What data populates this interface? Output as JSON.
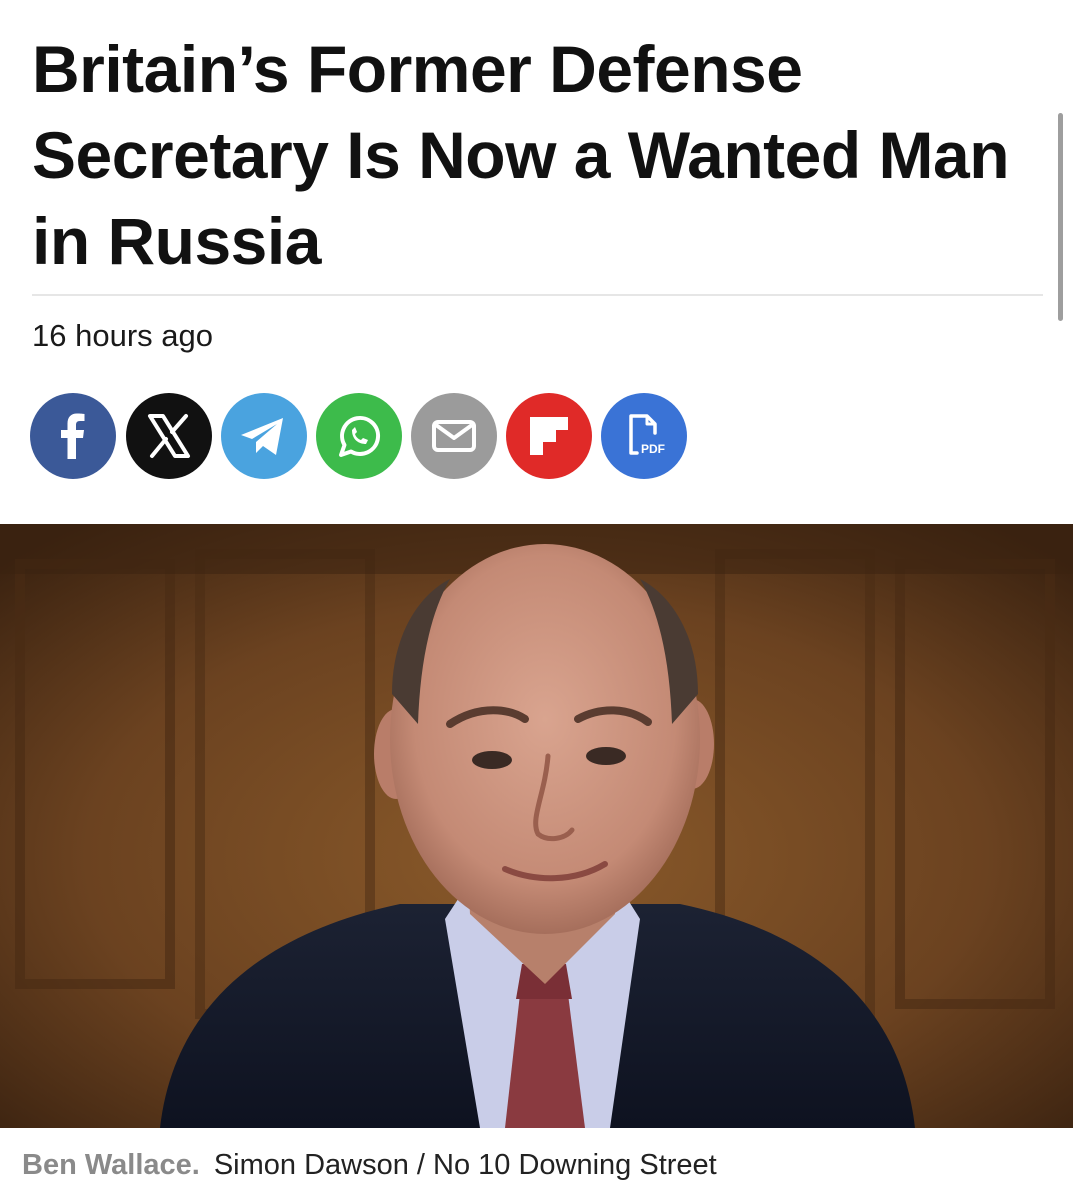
{
  "article": {
    "headline": "Britain’s Former Defense Secretary Is Now a Wanted Man in Russia",
    "timestamp": "16 hours ago"
  },
  "share": {
    "buttons": [
      {
        "name": "facebook",
        "icon": "facebook-icon",
        "color": "#3b5998"
      },
      {
        "name": "x",
        "icon": "x-icon",
        "color": "#111111"
      },
      {
        "name": "telegram",
        "icon": "telegram-icon",
        "color": "#4aa3df"
      },
      {
        "name": "whatsapp",
        "icon": "whatsapp-icon",
        "color": "#3dbb4b"
      },
      {
        "name": "email",
        "icon": "email-icon",
        "color": "#9b9b9b"
      },
      {
        "name": "flipboard",
        "icon": "flipboard-icon",
        "color": "#e02a28"
      },
      {
        "name": "pdf",
        "icon": "pdf-icon",
        "color": "#3a73d6",
        "label": "PDF"
      }
    ]
  },
  "image": {
    "caption_name": "Ben Wallace.",
    "caption_credit": "Simon Dawson / No 10 Downing Street"
  }
}
